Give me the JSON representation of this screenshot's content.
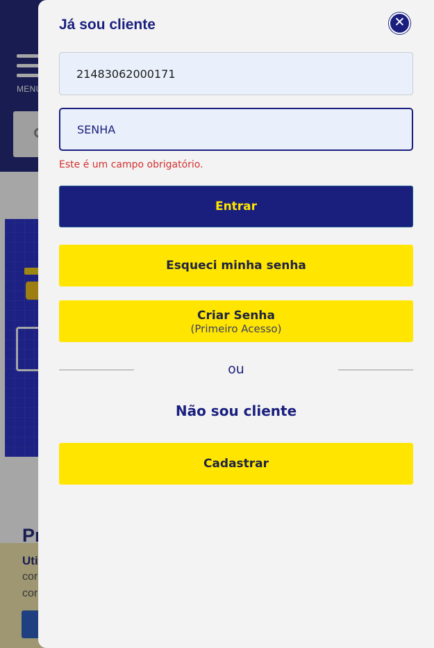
{
  "background": {
    "menu_label": "MENU",
    "heading": "Pr",
    "cookie": {
      "title": "Uti",
      "line1": "cor",
      "line2": "cor"
    }
  },
  "modal": {
    "title": "Já sou cliente",
    "close_icon": "close-icon",
    "username": {
      "value": "21483062000171"
    },
    "password": {
      "value": "",
      "placeholder": "SENHA"
    },
    "error": "Este é um campo obrigatório.",
    "login_label": "Entrar",
    "forgot_label": "Esqueci minha senha",
    "create_label": "Criar Senha",
    "create_sublabel": "(Primeiro Acesso)",
    "divider_text": "ou",
    "new_customer_title": "Não sou cliente",
    "register_label": "Cadastrar"
  },
  "colors": {
    "brand_blue": "#1a1f7e",
    "brand_yellow": "#ffe500",
    "error_red": "#d32f2f",
    "field_bg": "#e9f0fb"
  }
}
